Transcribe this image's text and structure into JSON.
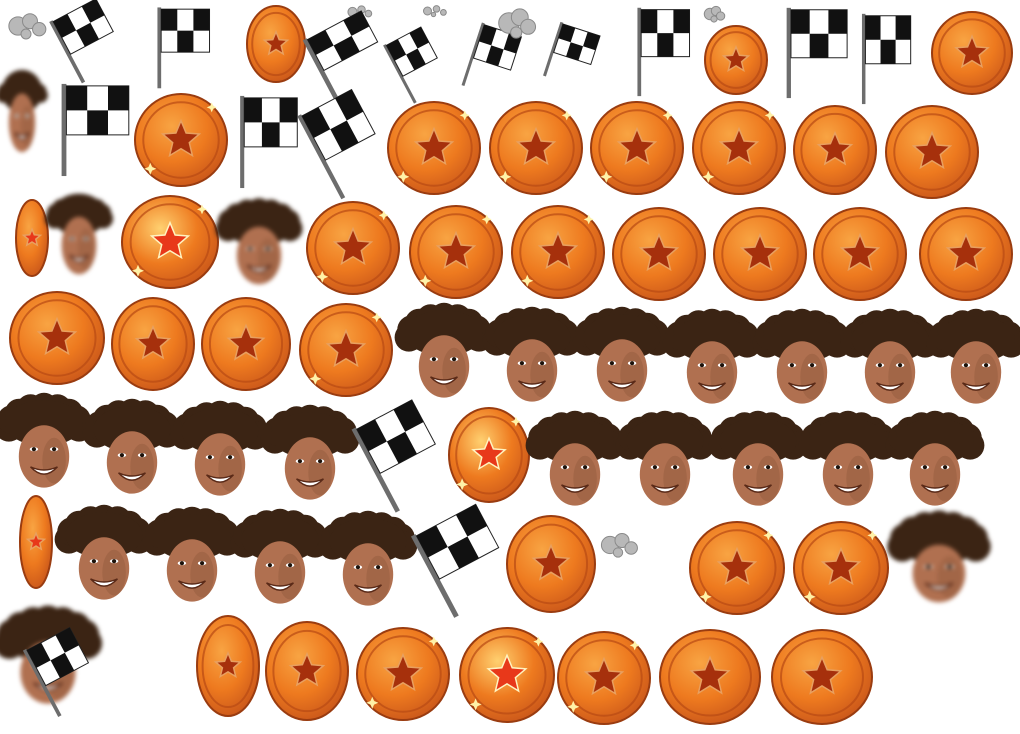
{
  "sheet": {
    "frame_kinds": [
      "coin",
      "face",
      "flag",
      "dust"
    ],
    "rows": [
      [
        "dust",
        "flag",
        "flag",
        "coin",
        "dust",
        "flag",
        "flag",
        "dust",
        "flag",
        "flag",
        "dust",
        "flag",
        "coin",
        "dust",
        "flag",
        "flag",
        "coin"
      ],
      [
        "face",
        "flag",
        "coin",
        "flag",
        "flag",
        "coin",
        "coin",
        "coin",
        "coin",
        "coin",
        "coin"
      ],
      [
        "coin",
        "face",
        "coin",
        "face",
        "coin",
        "coin",
        "coin",
        "coin",
        "coin",
        "coin",
        "coin"
      ],
      [
        "coin",
        "coin",
        "coin",
        "coin",
        "face",
        "face",
        "face",
        "face",
        "face",
        "face",
        "face"
      ],
      [
        "face",
        "face",
        "face",
        "face",
        "flag",
        "coin",
        "face",
        "face",
        "face",
        "face",
        "face"
      ],
      [
        "coin",
        "face",
        "face",
        "face",
        "face",
        "flag",
        "coin",
        "dust",
        "coin",
        "coin",
        "face"
      ],
      [
        "face",
        "flag",
        "coin",
        "coin",
        "coin",
        "coin",
        "coin",
        "coin",
        "coin"
      ]
    ]
  },
  "colors": {
    "background": "#ffffff",
    "coin_outer": "#c9561a",
    "coin_mid": "#ee7a1f",
    "coin_light": "#f8a443",
    "star_fill": "#a6300c",
    "star_bright": "#e8381a",
    "sparkle": "#fff2a8",
    "hair": "#3b2414",
    "skin": "#b07050",
    "skin_shade": "#8a5336",
    "flag_pole": "#6d6d6d",
    "checker_dark": "#111111",
    "checker_light": "#ffffff",
    "dust": "#b8b8b8"
  }
}
